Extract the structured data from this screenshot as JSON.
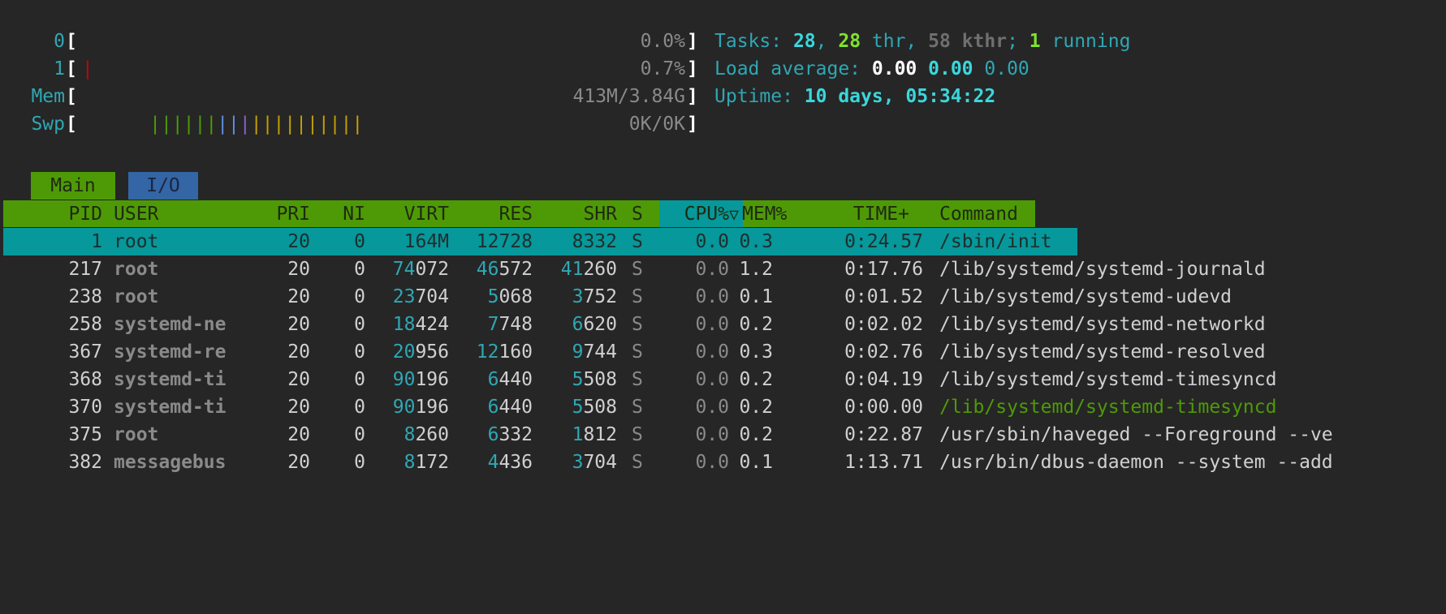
{
  "meters": {
    "cpu0": {
      "label": "0",
      "value": "0.0%"
    },
    "cpu1": {
      "label": "1",
      "value": "0.7%",
      "bar": "|"
    },
    "mem": {
      "label": "Mem",
      "value": "413M/3.84G",
      "bars": [
        {
          "chars": "||||||",
          "color": "#4e9a06"
        },
        {
          "chars": "||",
          "color": "#5f8fe0"
        },
        {
          "chars": "|",
          "color": "#8a5fd0"
        },
        {
          "chars": "||||||||||",
          "color": "#c4a000"
        }
      ]
    },
    "swp": {
      "label": "Swp",
      "value": "0K/0K"
    },
    "open_bracket": "[",
    "close_bracket": "]"
  },
  "summary": {
    "tasks_label": "Tasks: ",
    "tasks": "28",
    "sep1": ", ",
    "threads": "28",
    "thr_label": " thr, ",
    "kthreads": "58",
    "kthr_label": " kthr",
    "sep2": "; ",
    "running": "1",
    "running_label": " running",
    "load_label": "Load average: ",
    "load1": "0.00",
    "load5": "0.00",
    "load15": "0.00",
    "uptime_label": "Uptime: ",
    "uptime": "10 days, 05:34:22"
  },
  "tabs": [
    {
      "label": "Main",
      "active": true
    },
    {
      "label": "I/O",
      "active": false
    }
  ],
  "columns": {
    "pid": "PID",
    "user": "USER",
    "pri": "PRI",
    "ni": "NI",
    "virt": "VIRT",
    "res": "RES",
    "shr": "SHR",
    "s": "S",
    "cpu": "CPU%",
    "sort_indicator": "▽",
    "mem": "MEM%",
    "time": "TIME+",
    "command": "Command"
  },
  "processes": [
    {
      "pid": "1",
      "user": "root",
      "pri": "20",
      "ni": "0",
      "virt": "164M",
      "res": "12728",
      "shr": "8332",
      "s": "S",
      "cpu": "0.0",
      "mem": "0.3",
      "time": "0:24.57",
      "command": "/sbin/init"
    },
    {
      "pid": "217",
      "user": "root",
      "pri": "20",
      "ni": "0",
      "virt": "74072",
      "res": "46572",
      "shr": "41260",
      "s": "S",
      "cpu": "0.0",
      "mem": "1.2",
      "time": "0:17.76",
      "command": "/lib/systemd/systemd-journald"
    },
    {
      "pid": "238",
      "user": "root",
      "pri": "20",
      "ni": "0",
      "virt": "23704",
      "res": "5068",
      "shr": "3752",
      "s": "S",
      "cpu": "0.0",
      "mem": "0.1",
      "time": "0:01.52",
      "command": "/lib/systemd/systemd-udevd"
    },
    {
      "pid": "258",
      "user": "systemd-ne",
      "pri": "20",
      "ni": "0",
      "virt": "18424",
      "res": "7748",
      "shr": "6620",
      "s": "S",
      "cpu": "0.0",
      "mem": "0.2",
      "time": "0:02.02",
      "command": "/lib/systemd/systemd-networkd"
    },
    {
      "pid": "367",
      "user": "systemd-re",
      "pri": "20",
      "ni": "0",
      "virt": "20956",
      "res": "12160",
      "shr": "9744",
      "s": "S",
      "cpu": "0.0",
      "mem": "0.3",
      "time": "0:02.76",
      "command": "/lib/systemd/systemd-resolved"
    },
    {
      "pid": "368",
      "user": "systemd-ti",
      "pri": "20",
      "ni": "0",
      "virt": "90196",
      "res": "6440",
      "shr": "5508",
      "s": "S",
      "cpu": "0.0",
      "mem": "0.2",
      "time": "0:04.19",
      "command": "/lib/systemd/systemd-timesyncd"
    },
    {
      "pid": "370",
      "user": "systemd-ti",
      "pri": "20",
      "ni": "0",
      "virt": "90196",
      "res": "6440",
      "shr": "5508",
      "s": "S",
      "cpu": "0.0",
      "mem": "0.2",
      "time": "0:00.00",
      "command": "/lib/systemd/systemd-timesyncd"
    },
    {
      "pid": "375",
      "user": "root",
      "pri": "20",
      "ni": "0",
      "virt": "8260",
      "res": "6332",
      "shr": "1812",
      "s": "S",
      "cpu": "0.0",
      "mem": "0.2",
      "time": "0:22.87",
      "command": "/usr/sbin/haveged --Foreground --ve"
    },
    {
      "pid": "382",
      "user": "messagebus",
      "pri": "20",
      "ni": "0",
      "virt": "8172",
      "res": "4436",
      "shr": "3704",
      "s": "S",
      "cpu": "0.0",
      "mem": "0.1",
      "time": "1:13.71",
      "command": "/usr/bin/dbus-daemon --system --add"
    }
  ],
  "colors": {
    "background": "#262626",
    "header_bg": "#4e9a06",
    "selection_bg": "#06989a",
    "tab_active_bg": "#4e9a06",
    "tab_inactive_bg": "#3465a4",
    "thread_command": "#4e9a06"
  }
}
